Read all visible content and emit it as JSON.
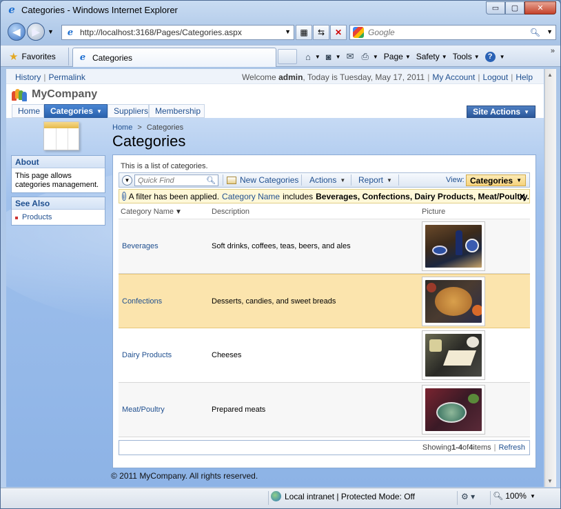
{
  "window": {
    "title": "Categories - Windows Internet Explorer",
    "minimize": "▭",
    "maximize": "▢",
    "close": "✕"
  },
  "address": {
    "url": "http://localhost:3168/Pages/Categories.aspx",
    "search_placeholder": "Google"
  },
  "commandbar": {
    "favorites": "Favorites",
    "tab_title": "Categories",
    "page": "Page",
    "safety": "Safety",
    "tools": "Tools",
    "help": "?"
  },
  "toplinks": {
    "history": "History",
    "permalink": "Permalink",
    "welcome_prefix": "Welcome ",
    "user": "admin",
    "welcome_suffix": ", Today is Tuesday, May 17, 2011",
    "my_account": "My Account",
    "logout": "Logout",
    "help": "Help"
  },
  "brand": {
    "name": "MyCompany"
  },
  "menu": {
    "home": "Home",
    "categories": "Categories",
    "suppliers": "Suppliers",
    "membership": "Membership",
    "site_actions": "Site Actions"
  },
  "breadcrumb": {
    "home": "Home",
    "sep": ">",
    "current": "Categories"
  },
  "page_title": "Categories",
  "about": {
    "title": "About",
    "text": "This page allows categories management."
  },
  "see_also": {
    "title": "See Also",
    "items": [
      "Products"
    ]
  },
  "main": {
    "description": "This is a list of categories.",
    "quick_find_placeholder": "Quick Find",
    "new_button": "New Categories",
    "actions": "Actions",
    "report": "Report",
    "view_label": "View:",
    "view_value": "Categories"
  },
  "filter": {
    "prefix": "A filter has been applied.",
    "field": "Category Name",
    "op": "includes",
    "values": "Beverages, Confections, Dairy Products, Meat/Poultry.",
    "close": "X"
  },
  "grid": {
    "columns": [
      "Category Name",
      "Description",
      "Picture"
    ],
    "rows": [
      {
        "name": "Beverages",
        "description": "Soft drinks, coffees, teas, beers, and ales"
      },
      {
        "name": "Confections",
        "description": "Desserts, candies, and sweet breads"
      },
      {
        "name": "Dairy Products",
        "description": "Cheeses"
      },
      {
        "name": "Meat/Poultry",
        "description": "Prepared meats"
      }
    ]
  },
  "pager": {
    "showing": "Showing ",
    "range": "1-4",
    "of": " of ",
    "total": "4",
    "items": " items",
    "refresh": "Refresh"
  },
  "footer": "© 2011 MyCompany. All rights reserved.",
  "status": {
    "zone": "Local intranet | Protected Mode: Off",
    "zoom": "100%"
  }
}
